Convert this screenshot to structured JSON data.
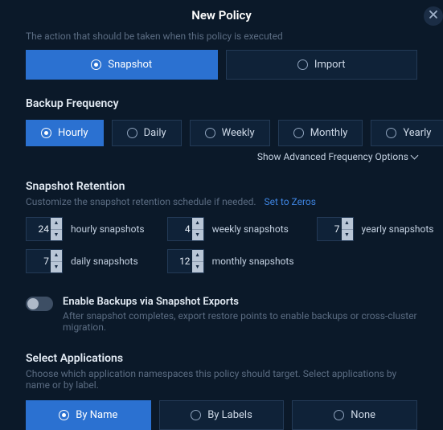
{
  "header": {
    "title": "New Policy"
  },
  "action": {
    "desc": "The action that should be taken when this policy is executed",
    "options": {
      "snapshot": "Snapshot",
      "import": "Import"
    }
  },
  "frequency": {
    "title": "Backup Frequency",
    "options": {
      "hourly": "Hourly",
      "daily": "Daily",
      "weekly": "Weekly",
      "monthly": "Monthly",
      "yearly": "Yearly"
    },
    "advanced": "Show Advanced Frequency Options"
  },
  "retention": {
    "title": "Snapshot Retention",
    "desc": "Customize the snapshot retention schedule if needed.",
    "zeros": "Set to Zeros",
    "hourly": {
      "value": "24",
      "label": "hourly snapshots"
    },
    "daily": {
      "value": "7",
      "label": "daily snapshots"
    },
    "weekly": {
      "value": "4",
      "label": "weekly snapshots"
    },
    "monthly": {
      "value": "12",
      "label": "monthly snapshots"
    },
    "yearly": {
      "value": "7",
      "label": "yearly snapshots"
    }
  },
  "exports": {
    "label": "Enable Backups via Snapshot Exports",
    "desc": "After snapshot completes, export restore points to enable backups or cross-cluster migration."
  },
  "apps": {
    "title": "Select Applications",
    "desc": "Choose which application namespaces this policy should target. Select applications by name or by label.",
    "options": {
      "name": "By Name",
      "labels": "By Labels",
      "none": "None"
    }
  }
}
